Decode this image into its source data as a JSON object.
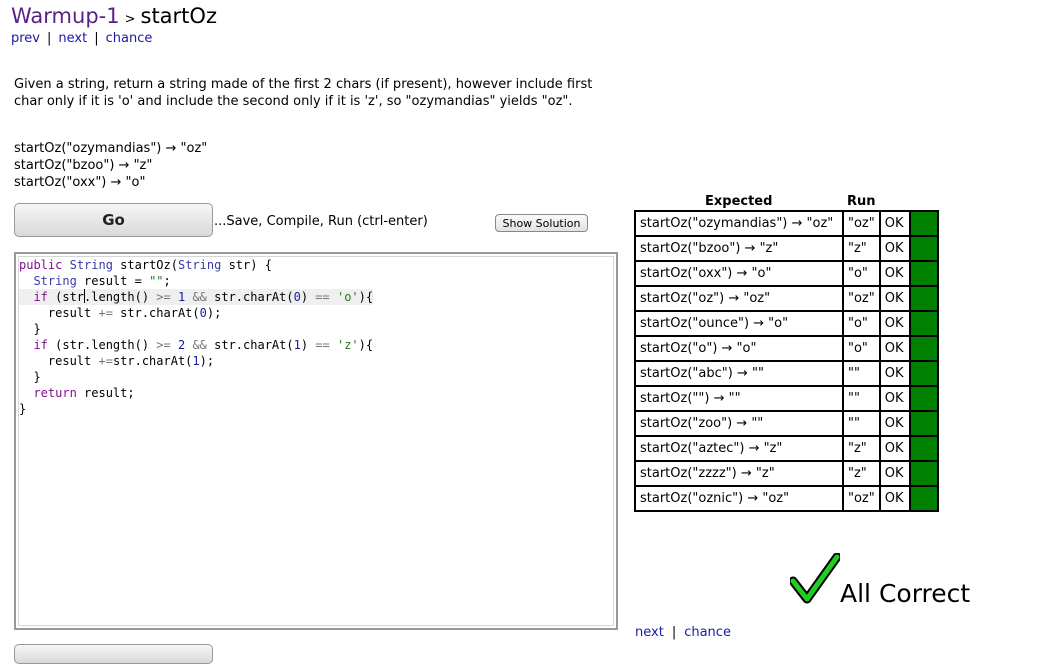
{
  "header": {
    "section": "Warmup-1",
    "separator": ">",
    "problem": "startOz"
  },
  "nav": {
    "prev": "prev",
    "next": "next",
    "chance": "chance",
    "divider": "|"
  },
  "prompt": "Given a string, return a string made of the first 2 chars (if present), however include first char only if it is 'o' and include the second only if it is 'z', so \"ozymandias\" yields \"oz\".",
  "examples": [
    "startOz(\"ozymandias\") → \"oz\"",
    "startOz(\"bzoo\") → \"z\"",
    "startOz(\"oxx\") → \"o\""
  ],
  "controls": {
    "go_label": "Go",
    "go_hint": "...Save, Compile, Run (ctrl-enter)",
    "show_solution_label": "Show Solution"
  },
  "editor": {
    "lines": [
      "public String startOz(String str) {",
      "  String result = \"\";",
      "  if (str.length() >= 1 && str.charAt(0) == 'o'){",
      "    result += str.charAt(0);",
      "  }",
      "  if (str.length() >= 2 && str.charAt(1) == 'z'){",
      "    result +=str.charAt(1);",
      "  }",
      "  return result;",
      "}"
    ]
  },
  "results": {
    "headers": {
      "expected": "Expected",
      "run": "Run"
    },
    "status_color": "#008000",
    "rows": [
      {
        "expected": "startOz(\"ozymandias\") → \"oz\"",
        "run": "\"oz\"",
        "result": "OK"
      },
      {
        "expected": "startOz(\"bzoo\") → \"z\"",
        "run": "\"z\"",
        "result": "OK"
      },
      {
        "expected": "startOz(\"oxx\") → \"o\"",
        "run": "\"o\"",
        "result": "OK"
      },
      {
        "expected": "startOz(\"oz\") → \"oz\"",
        "run": "\"oz\"",
        "result": "OK"
      },
      {
        "expected": "startOz(\"ounce\") → \"o\"",
        "run": "\"o\"",
        "result": "OK"
      },
      {
        "expected": "startOz(\"o\") → \"o\"",
        "run": "\"o\"",
        "result": "OK"
      },
      {
        "expected": "startOz(\"abc\") → \"\"",
        "run": "\"\"",
        "result": "OK"
      },
      {
        "expected": "startOz(\"\") → \"\"",
        "run": "\"\"",
        "result": "OK"
      },
      {
        "expected": "startOz(\"zoo\") → \"\"",
        "run": "\"\"",
        "result": "OK"
      },
      {
        "expected": "startOz(\"aztec\") → \"z\"",
        "run": "\"z\"",
        "result": "OK"
      },
      {
        "expected": "startOz(\"zzzz\") → \"z\"",
        "run": "\"z\"",
        "result": "OK"
      },
      {
        "expected": "startOz(\"oznic\") → \"oz\"",
        "run": "\"oz\"",
        "result": "OK"
      }
    ]
  },
  "summary": {
    "icon": "checkmark-icon",
    "text": "All Correct",
    "check_color": "#22cc22"
  },
  "footer_nav": {
    "next": "next",
    "chance": "chance",
    "divider": "|"
  }
}
